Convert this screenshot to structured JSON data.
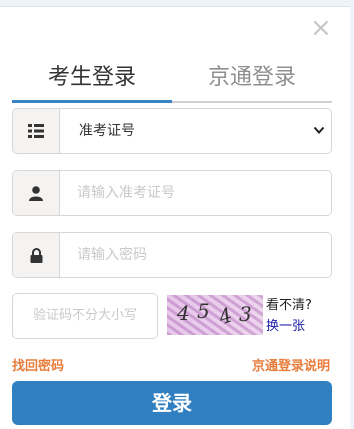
{
  "close_icon": "close-icon",
  "tabs": [
    {
      "label": "考生登录",
      "active": true
    },
    {
      "label": "京通登录",
      "active": false
    }
  ],
  "id_type": {
    "icon": "list-icon",
    "selected": "准考证号"
  },
  "exam_number": {
    "icon": "user-icon",
    "placeholder": "请输入准考证号"
  },
  "password": {
    "icon": "lock-icon",
    "placeholder": "请输入密码"
  },
  "captcha": {
    "placeholder": "验证码不分大小写",
    "chars": [
      "4",
      "5",
      "4",
      "3"
    ],
    "unclear_label": "看不清?",
    "refresh_label": "换一张"
  },
  "links": {
    "recover_password": "找回密码",
    "jingtong_help": "京通登录说明"
  },
  "submit_label": "登录",
  "colors": {
    "accent": "#2f7fc1",
    "link": "#e87c3b",
    "refresh_link": "#1a1aa6"
  }
}
